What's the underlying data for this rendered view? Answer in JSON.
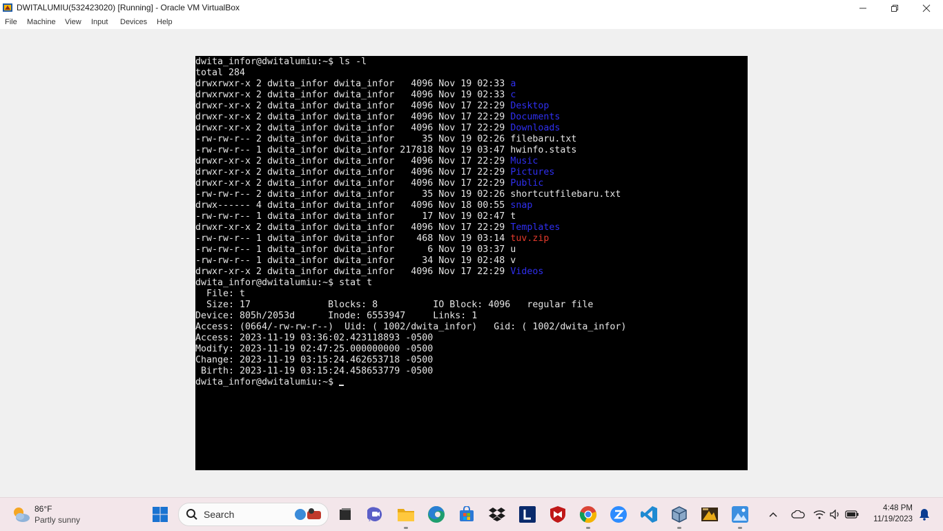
{
  "window": {
    "title": "DWITALUMIU(532423020) [Running] - Oracle VM VirtualBox",
    "menu": [
      "File",
      "Machine",
      "View",
      "Input",
      "Devices",
      "Help"
    ]
  },
  "terminal": {
    "lines": [
      [
        {
          "t": "dwita_infor@dwitalumiu:~$ ls -l",
          "c": ""
        }
      ],
      [
        {
          "t": "total 284",
          "c": ""
        }
      ],
      [
        {
          "t": "drwxrwxr-x 2 dwita_infor dwita_infor   4096 Nov 19 02:33 ",
          "c": ""
        },
        {
          "t": "a",
          "c": "blue"
        }
      ],
      [
        {
          "t": "drwxrwxr-x 2 dwita_infor dwita_infor   4096 Nov 19 02:33 ",
          "c": ""
        },
        {
          "t": "c",
          "c": "blue"
        }
      ],
      [
        {
          "t": "drwxr-xr-x 2 dwita_infor dwita_infor   4096 Nov 17 22:29 ",
          "c": ""
        },
        {
          "t": "Desktop",
          "c": "blue"
        }
      ],
      [
        {
          "t": "drwxr-xr-x 2 dwita_infor dwita_infor   4096 Nov 17 22:29 ",
          "c": ""
        },
        {
          "t": "Documents",
          "c": "blue"
        }
      ],
      [
        {
          "t": "drwxr-xr-x 2 dwita_infor dwita_infor   4096 Nov 17 22:29 ",
          "c": ""
        },
        {
          "t": "Downloads",
          "c": "blue"
        }
      ],
      [
        {
          "t": "-rw-rw-r-- 2 dwita_infor dwita_infor     35 Nov 19 02:26 filebaru.txt",
          "c": ""
        }
      ],
      [
        {
          "t": "-rw-rw-r-- 1 dwita_infor dwita_infor 217818 Nov 19 03:47 hwinfo.stats",
          "c": ""
        }
      ],
      [
        {
          "t": "drwxr-xr-x 2 dwita_infor dwita_infor   4096 Nov 17 22:29 ",
          "c": ""
        },
        {
          "t": "Music",
          "c": "blue"
        }
      ],
      [
        {
          "t": "drwxr-xr-x 2 dwita_infor dwita_infor   4096 Nov 17 22:29 ",
          "c": ""
        },
        {
          "t": "Pictures",
          "c": "blue"
        }
      ],
      [
        {
          "t": "drwxr-xr-x 2 dwita_infor dwita_infor   4096 Nov 17 22:29 ",
          "c": ""
        },
        {
          "t": "Public",
          "c": "blue"
        }
      ],
      [
        {
          "t": "-rw-rw-r-- 2 dwita_infor dwita_infor     35 Nov 19 02:26 shortcutfilebaru.txt",
          "c": ""
        }
      ],
      [
        {
          "t": "drwx------ 4 dwita_infor dwita_infor   4096 Nov 18 00:55 ",
          "c": ""
        },
        {
          "t": "snap",
          "c": "blue"
        }
      ],
      [
        {
          "t": "-rw-rw-r-- 1 dwita_infor dwita_infor     17 Nov 19 02:47 t",
          "c": ""
        }
      ],
      [
        {
          "t": "drwxr-xr-x 2 dwita_infor dwita_infor   4096 Nov 17 22:29 ",
          "c": ""
        },
        {
          "t": "Templates",
          "c": "blue"
        }
      ],
      [
        {
          "t": "-rw-rw-r-- 1 dwita_infor dwita_infor    468 Nov 19 03:14 ",
          "c": ""
        },
        {
          "t": "tuv.zip",
          "c": "red"
        }
      ],
      [
        {
          "t": "-rw-rw-r-- 1 dwita_infor dwita_infor      6 Nov 19 03:37 u",
          "c": ""
        }
      ],
      [
        {
          "t": "-rw-rw-r-- 1 dwita_infor dwita_infor     34 Nov 19 02:48 v",
          "c": ""
        }
      ],
      [
        {
          "t": "drwxr-xr-x 2 dwita_infor dwita_infor   4096 Nov 17 22:29 ",
          "c": ""
        },
        {
          "t": "Videos",
          "c": "blue"
        }
      ],
      [
        {
          "t": "dwita_infor@dwitalumiu:~$ stat t",
          "c": ""
        }
      ],
      [
        {
          "t": "  File: t",
          "c": ""
        }
      ],
      [
        {
          "t": "  Size: 17              Blocks: 8          IO Block: 4096   regular file",
          "c": ""
        }
      ],
      [
        {
          "t": "Device: 805h/2053d      Inode: 6553947     Links: 1",
          "c": ""
        }
      ],
      [
        {
          "t": "Access: (0664/-rw-rw-r--)  Uid: ( 1002/dwita_infor)   Gid: ( 1002/dwita_infor)",
          "c": ""
        }
      ],
      [
        {
          "t": "Access: 2023-11-19 03:36:02.423118893 -0500",
          "c": ""
        }
      ],
      [
        {
          "t": "Modify: 2023-11-19 02:47:25.000000000 -0500",
          "c": ""
        }
      ],
      [
        {
          "t": "Change: 2023-11-19 03:15:24.462653718 -0500",
          "c": ""
        }
      ],
      [
        {
          "t": " Birth: 2023-11-19 03:15:24.458653779 -0500",
          "c": ""
        }
      ],
      [
        {
          "t": "dwita_infor@dwitalumiu:~$ ",
          "c": "",
          "cursor": true
        }
      ]
    ]
  },
  "taskbar": {
    "weather": {
      "temp": "86°F",
      "desc": "Partly sunny"
    },
    "search_placeholder": "Search",
    "apps": [
      "start",
      "search",
      "task-view",
      "teams-meet",
      "file-explorer",
      "edge",
      "microsoft-store",
      "dropbox",
      "l-app",
      "mcafee",
      "chrome",
      "zoom",
      "vscode",
      "virtualbox",
      "photo-app",
      "windows-app"
    ],
    "clock": {
      "time": "4:48 PM",
      "date": "11/19/2023"
    }
  },
  "colors": {
    "accent_blue": "#2f2ff0",
    "archive_red": "#e43a2c",
    "taskbar_bg": "#f3e6ea"
  }
}
